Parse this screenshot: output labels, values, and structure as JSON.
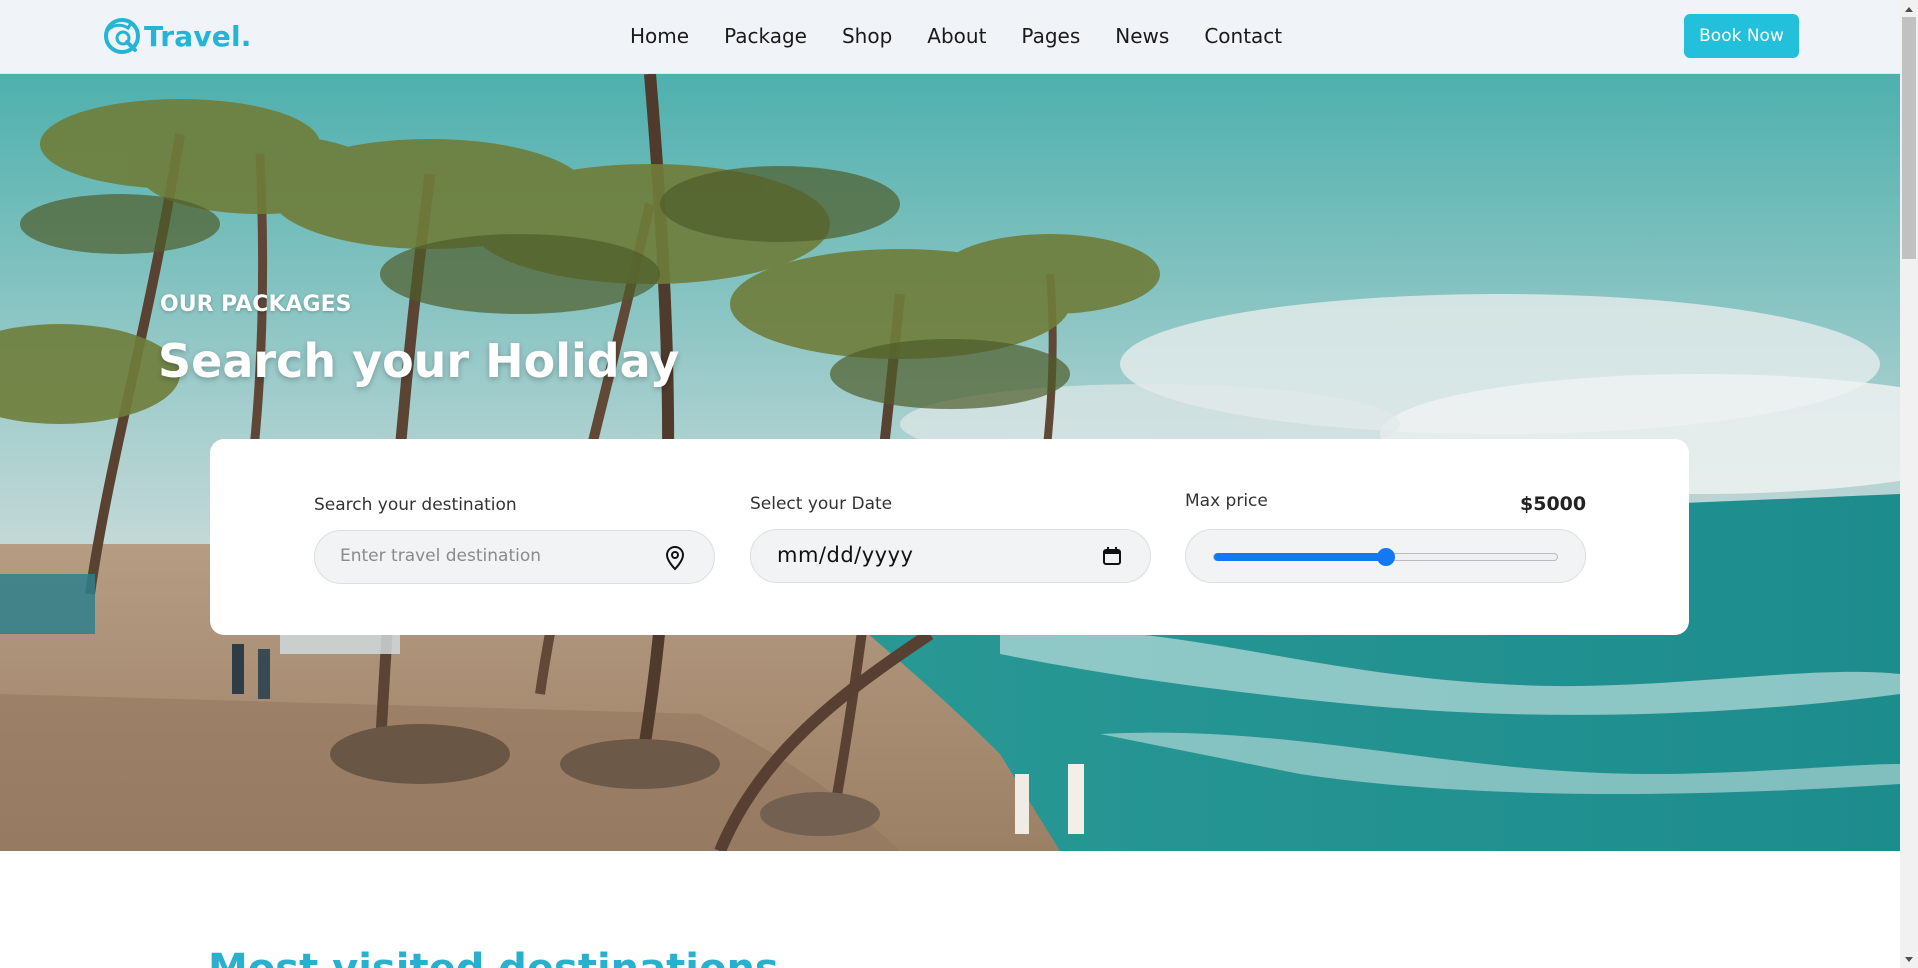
{
  "header": {
    "logo_text": "Travel.",
    "nav": [
      {
        "label": "Home"
      },
      {
        "label": "Package"
      },
      {
        "label": "Shop"
      },
      {
        "label": "About"
      },
      {
        "label": "Pages"
      },
      {
        "label": "News"
      },
      {
        "label": "Contact"
      }
    ],
    "book_label": "Book Now"
  },
  "hero": {
    "kicker": "OUR PACKAGES",
    "title": "Search your Holiday"
  },
  "search": {
    "destination_label": "Search your destination",
    "destination_placeholder": "Enter travel destination",
    "date_label": "Select your Date",
    "date_placeholder": "mm/dd/yyyy",
    "price_label": "Max price",
    "price_value": "$5000",
    "price_slider_fraction": 0.5
  },
  "section": {
    "heading": "Most visited destinations"
  },
  "colors": {
    "brand": "#23b5d3",
    "button": "#23c0dc",
    "slider": "#1478f0",
    "heading": "#2ab0cf"
  },
  "icons": {
    "logo": "travel-logo-icon",
    "destination": "map-pin-icon",
    "date": "calendar-icon"
  }
}
